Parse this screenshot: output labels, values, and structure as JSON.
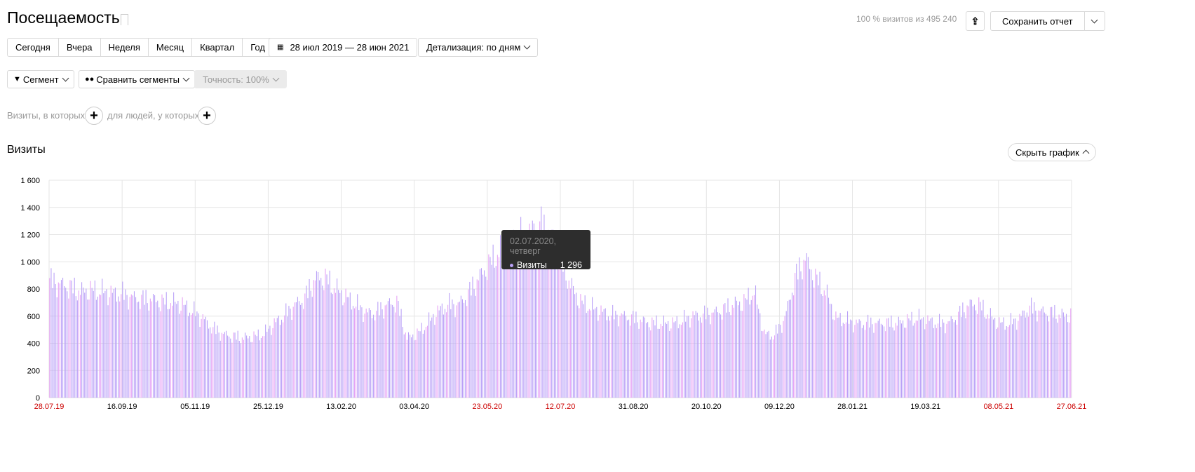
{
  "header": {
    "title": "Посещаемость",
    "sampling_info": "100 % визитов из 495 240",
    "save_label": "Сохранить отчет"
  },
  "periods": [
    "Сегодня",
    "Вчера",
    "Неделя",
    "Месяц",
    "Квартал",
    "Год"
  ],
  "date_range": "28 июл 2019 — 28 июн 2021",
  "detail": "Детализация: по дням",
  "segment": "Сегмент",
  "compare": "Сравнить сегменты",
  "accuracy": "Точность: 100%",
  "filters": {
    "visits_label": "Визиты, в которых",
    "people_label": "для людей, у которых"
  },
  "section_title": "Визиты",
  "hide_chart": "Скрыть график",
  "tooltip": {
    "date": "02.07.2020, четверг",
    "metric": "Визиты",
    "value": "1 296"
  },
  "colors": {
    "weekday": "#b9a0f7",
    "weekend": "#e6a3f5",
    "red_label": "#cc0000"
  },
  "chart_data": {
    "type": "bar",
    "title": "Визиты",
    "ylim": [
      0,
      1600
    ],
    "yticks": [
      "0",
      "200",
      "400",
      "600",
      "800",
      "1 000",
      "1 200",
      "1 400",
      "1 600"
    ],
    "xticks": [
      {
        "label": "28.07.19",
        "weekend": true
      },
      {
        "label": "16.09.19"
      },
      {
        "label": "05.11.19"
      },
      {
        "label": "25.12.19"
      },
      {
        "label": "13.02.20"
      },
      {
        "label": "03.04.20"
      },
      {
        "label": "23.05.20",
        "weekend": true
      },
      {
        "label": "12.07.20",
        "weekend": true
      },
      {
        "label": "31.08.20"
      },
      {
        "label": "20.10.20"
      },
      {
        "label": "09.12.20"
      },
      {
        "label": "28.01.21"
      },
      {
        "label": "19.03.21"
      },
      {
        "label": "08.05.21",
        "weekend": true
      },
      {
        "label": "27.06.21",
        "weekend": true
      }
    ],
    "granularity": "weekly level (approx.), drawn as daily bars",
    "days_total": 701,
    "weekly_values": [
      880,
      860,
      830,
      800,
      810,
      800,
      790,
      780,
      760,
      740,
      740,
      720,
      720,
      700,
      650,
      600,
      520,
      480,
      460,
      450,
      460,
      480,
      560,
      620,
      700,
      750,
      900,
      900,
      820,
      760,
      700,
      640,
      640,
      700,
      720,
      450,
      480,
      560,
      650,
      700,
      700,
      780,
      900,
      1000,
      1100,
      1150,
      1200,
      1250,
      1300,
      1250,
      1050,
      850,
      720,
      680,
      650,
      620,
      620,
      600,
      580,
      560,
      560,
      560,
      580,
      620,
      620,
      640,
      660,
      700,
      720,
      800,
      480,
      470,
      600,
      900,
      1050,
      900,
      800,
      600,
      580,
      560,
      560,
      560,
      560,
      560,
      580,
      600,
      580,
      560,
      560,
      620,
      700,
      700,
      620,
      560,
      560,
      600,
      680,
      650,
      640,
      620
    ]
  }
}
